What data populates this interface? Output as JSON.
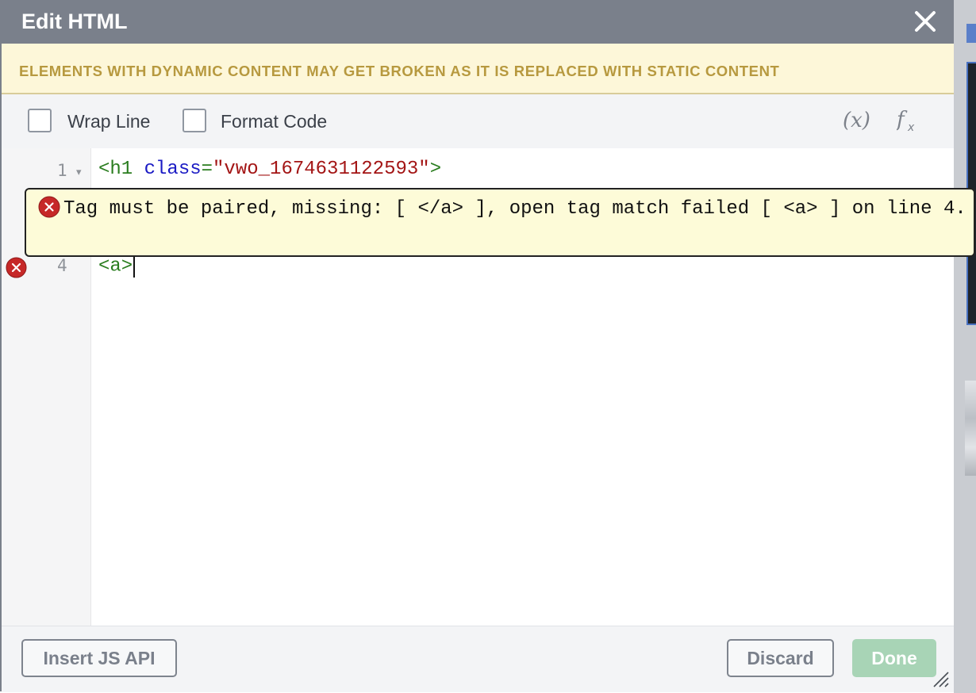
{
  "dialog": {
    "title": "Edit HTML",
    "close_icon": "close-icon"
  },
  "warning": {
    "text": "ELEMENTS WITH DYNAMIC CONTENT MAY GET BROKEN AS IT IS REPLACED WITH STATIC CONTENT"
  },
  "toolbar": {
    "wrap_line_label": "Wrap Line",
    "wrap_line_checked": false,
    "format_code_label": "Format Code",
    "format_code_checked": false,
    "variable_icon_glyph": "(x)",
    "function_icon_glyph": "fx"
  },
  "editor": {
    "lines": [
      {
        "number": "1",
        "fold": "▾",
        "tag_open": "<h1 ",
        "attr": "class",
        "eq": "=",
        "value": "\"vwo_1674631122593\"",
        "tag_close": ">"
      },
      {
        "number": "4",
        "code": "<a>"
      }
    ],
    "error": {
      "message": "Tag must be paired, missing: [ </a> ], open tag match failed [ <a> ] on line 4.",
      "icon": "error-icon"
    }
  },
  "footer": {
    "insert_js_api_label": "Insert JS API",
    "discard_label": "Discard",
    "done_label": "Done"
  },
  "colors": {
    "title_bar": "#7a808b",
    "warning_bg": "#fdf7d9",
    "warning_text": "#b7993f",
    "tag": "#2a7d1f",
    "attribute": "#1a1ac4",
    "string": "#a31515",
    "error_red": "#c62828",
    "done_disabled": "#a8d4b6"
  }
}
